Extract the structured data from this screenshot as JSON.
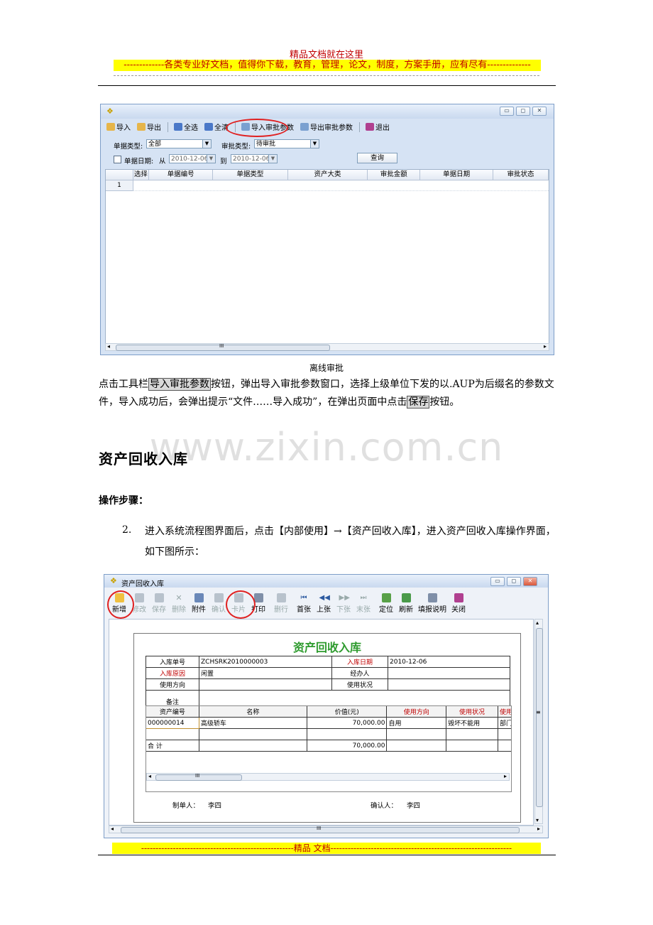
{
  "header": {
    "title": "精品文档就在这里",
    "banner": "-------------各类专业好文档，值得你下载，教育，管理，论文，制度，方案手册，应有尽有--------------"
  },
  "screenshot1": {
    "toolbar": [
      "导入",
      "导出",
      "全选",
      "全清",
      "导入审批参数",
      "导出审批参数",
      "退出"
    ],
    "filters": {
      "doc_type_label": "单据类型:",
      "doc_type_value": "全部",
      "approve_type_label": "审批类型:",
      "approve_type_value": "待审批",
      "date_label": "单据日期:",
      "from_label": "从",
      "from_value": "2010-12-06",
      "to_label": "到",
      "to_value": "2010-12-06",
      "query_button": "查询"
    },
    "columns": [
      "选择",
      "单据编号",
      "单据类型",
      "资产大类",
      "审批金额",
      "单据日期",
      "审批状态"
    ],
    "row_number": "1",
    "scroll_label": "III"
  },
  "caption1": "离线审批",
  "paragraph1": {
    "t1": "点击工具栏",
    "btn1": "导入审批参数",
    "t2": "按钮，弹出导入审批参数窗口，选择上级单位下发的以.AUP为后缀名的参数文件，导入成功后，会弹出提示“文件……导入成功”，在弹出页面中点击",
    "btn2": "保存",
    "t3": "按钮。"
  },
  "watermark": "www.zixin.com.cn",
  "section_title": "资产回收入库",
  "steps_title": "操作步骤：",
  "step": {
    "num": "2.",
    "text": "进入系统流程图界面后，点击【内部使用】→【资产回收入库】，进入资产回收入库操作界面，如下图所示："
  },
  "screenshot2": {
    "window_title": "资产回收入库",
    "toolbar": [
      "新增",
      "修改",
      "保存",
      "删除",
      "附件",
      "确认",
      "卡片",
      "打印",
      "删行",
      "首张",
      "上张",
      "下张",
      "末张",
      "定位",
      "刷新",
      "填报说明",
      "关闭"
    ],
    "form_title": "资产回收入库",
    "fields": {
      "in_no_label": "入库单号",
      "in_no_value": "ZCHSRK2010000003",
      "in_date_label": "入库日期",
      "in_date_value": "2010-12-06",
      "reason_label": "入库原因",
      "reason_value": "闲置",
      "handler_label": "经办人",
      "handler_value": "",
      "direction_label": "使用方向",
      "direction_value": "",
      "status_label": "使用状况",
      "status_value": "",
      "remark_label": "备注"
    },
    "columns": [
      "资产编号",
      "名称",
      "价值(元)",
      "使用方向",
      "使用状况",
      "使用"
    ],
    "rows": [
      {
        "code": "000000014",
        "name": "高级轿车",
        "value": "70,000.00",
        "direction": "自用",
        "status": "毁坏不能用",
        "dept": "部门"
      }
    ],
    "total_label": "合    计",
    "total_value": "70,000.00",
    "maker_label": "制单人：",
    "maker_value": "李四",
    "confirmer_label": "确认人：",
    "confirmer_value": "李四",
    "scroll_label": "III",
    "side_marker": "≡"
  },
  "footer": "-----------------------------------------------------精品    文档---------------------------------------------------------------",
  "colors": {
    "header_red": "#c00000",
    "highlight": "#ffff00",
    "annotation": "#e02020",
    "form_title_green": "#2e9b2e"
  }
}
